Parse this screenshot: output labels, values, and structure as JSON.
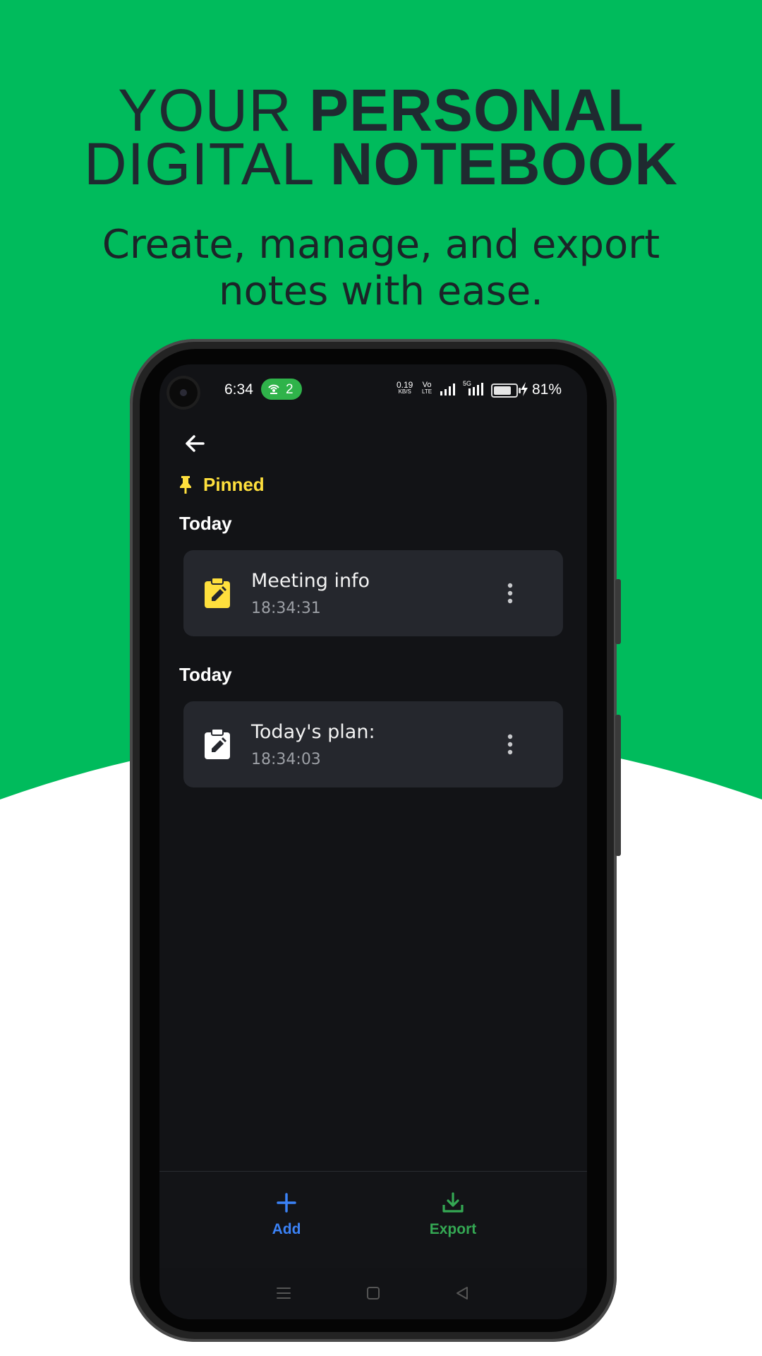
{
  "promo": {
    "headline_line1_light": "YOUR ",
    "headline_line1_bold": "PERSONAL",
    "headline_line2_light": "DIGITAL ",
    "headline_line2_bold": "NOTEBOOK",
    "subtitle_line1": "Create, manage, and export",
    "subtitle_line2": "notes with ease."
  },
  "colors": {
    "brand_green": "#00bb5c",
    "pinned_yellow": "#ffe03d",
    "add_blue": "#3b82f6",
    "export_green": "#34a853",
    "card_bg": "#25272d",
    "screen_bg": "#121316"
  },
  "status_bar": {
    "time": "6:34",
    "hotspot_count": "2",
    "net_speed_value": "0.19",
    "net_speed_unit": "KB/S",
    "volte_top": "Vo",
    "volte_bottom": "LTE",
    "fiveg": "5G",
    "battery_percent": "81%",
    "battery_level": 0.81
  },
  "app": {
    "back_icon": "arrow-left-icon",
    "pinned_label": "Pinned",
    "sections": [
      {
        "header": "Today",
        "note": {
          "title": "Meeting info",
          "time": "18:34:31",
          "icon": "clipboard-edit-icon",
          "icon_color": "#ffe03d"
        }
      },
      {
        "header": "Today",
        "note": {
          "title": "Today's plan:",
          "time": "18:34:03",
          "icon": "clipboard-edit-icon",
          "icon_color": "#ffffff"
        }
      }
    ],
    "bottom_nav": {
      "add_label": "Add",
      "export_label": "Export"
    }
  }
}
